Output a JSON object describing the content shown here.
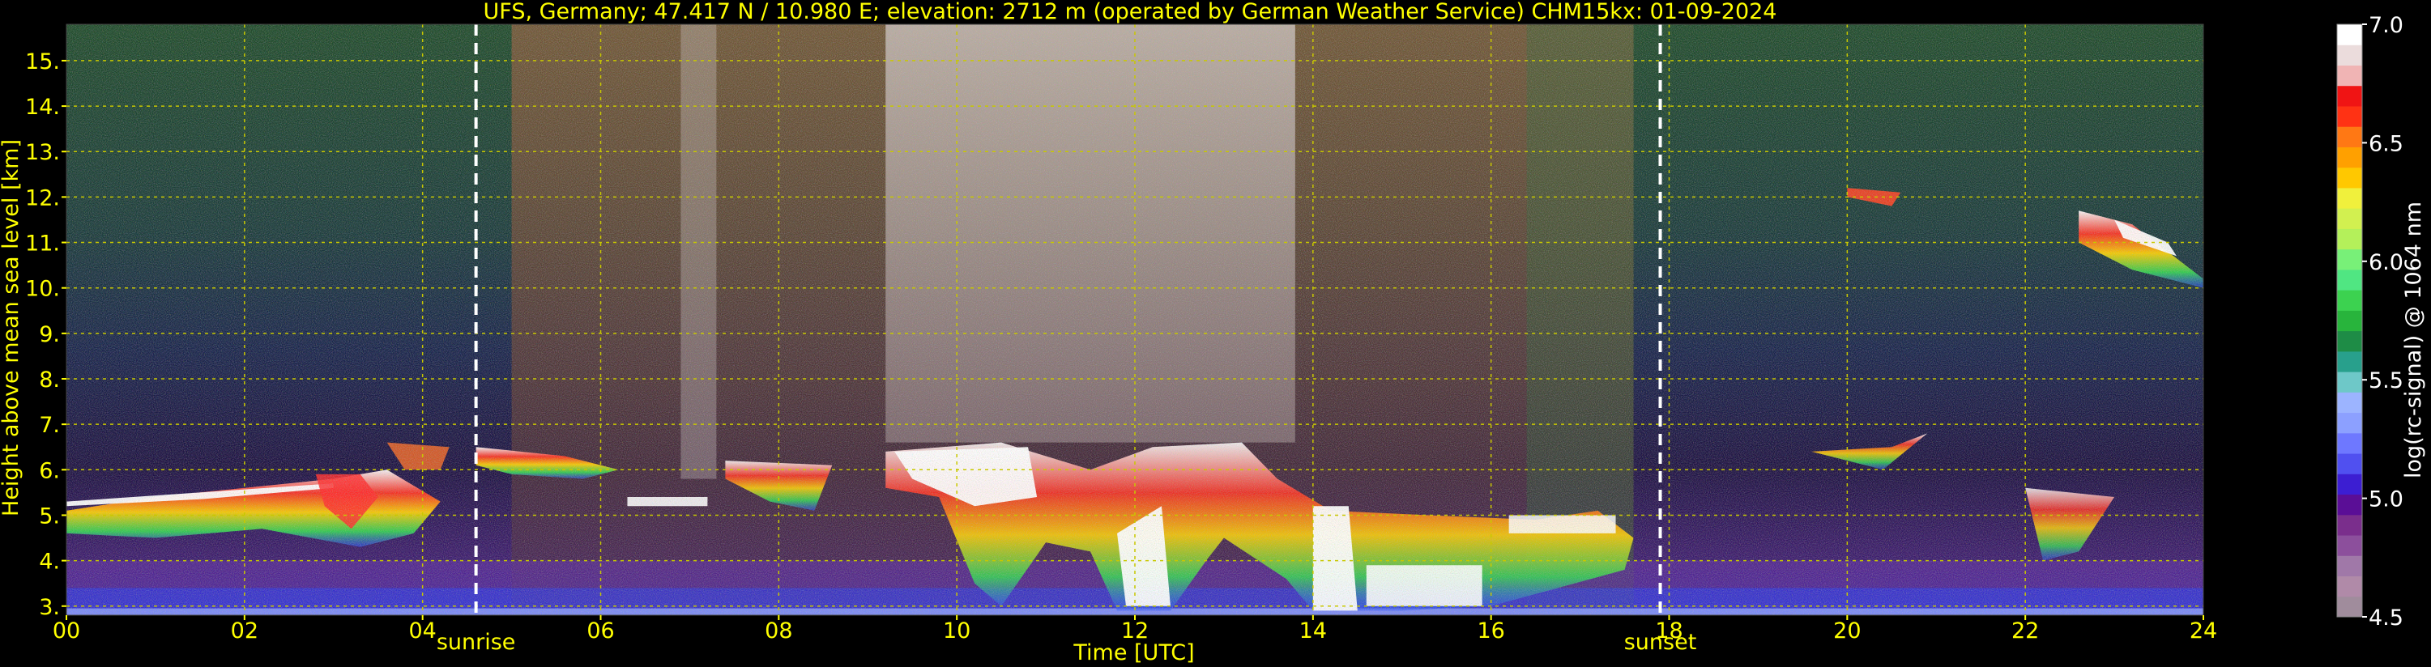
{
  "chart_data": {
    "type": "heatmap",
    "title": "UFS, Germany; 47.417 N / 10.980 E; elevation: 2712 m  (operated by German Weather Service)    CHM15kx: 01-09-2024",
    "xlabel": "Time [UTC]",
    "ylabel": "Height above mean sea level [km]",
    "xlim": [
      0,
      24
    ],
    "ylim": [
      2.8,
      15.8
    ],
    "x_ticks": [
      "00",
      "02",
      "04",
      "06",
      "08",
      "10",
      "12",
      "14",
      "16",
      "18",
      "20",
      "22",
      "24"
    ],
    "x_tick_values": [
      0,
      2,
      4,
      6,
      8,
      10,
      12,
      14,
      16,
      18,
      20,
      22,
      24
    ],
    "y_ticks": [
      "3.",
      "4.",
      "5.",
      "6.",
      "7.",
      "8.",
      "9.",
      "10.",
      "11.",
      "12.",
      "13.",
      "14.",
      "15."
    ],
    "y_tick_values": [
      3,
      4,
      5,
      6,
      7,
      8,
      9,
      10,
      11,
      12,
      13,
      14,
      15
    ],
    "grid": true,
    "annotations": [
      {
        "text": "sunrise",
        "x": 4.6
      },
      {
        "text": "sunset",
        "x": 17.9
      }
    ],
    "colorbar": {
      "label": "log(rc-signal) @ 1064 nm",
      "range": [
        4.5,
        7.0
      ],
      "ticks": [
        "4.5",
        "5.0",
        "5.5",
        "6.0",
        "6.5",
        "7.0"
      ],
      "tick_values": [
        4.5,
        5.0,
        5.5,
        6.0,
        6.5,
        7.0
      ],
      "colors": [
        "#a08c9c",
        "#b08aa8",
        "#a078a8",
        "#8c4f9c",
        "#7a2e8c",
        "#5a0e96",
        "#3c1ed2",
        "#5050f0",
        "#6e78ff",
        "#8ca0ff",
        "#9cb4ff",
        "#6ec8c8",
        "#28a08c",
        "#1e8c46",
        "#28b43c",
        "#3cd250",
        "#50e682",
        "#78f078",
        "#b4f05a",
        "#d2f050",
        "#f0f03c",
        "#ffc800",
        "#ffa000",
        "#ff7814",
        "#ff3214",
        "#f01414",
        "#f0b4b4",
        "#ebdcdc",
        "#ffffff"
      ]
    },
    "features": [
      {
        "name": "low cloud layer",
        "x_range": [
          0,
          4.3
        ],
        "height_km": [
          4.6,
          6.0
        ]
      },
      {
        "name": "sunrise marker",
        "x": 4.6
      },
      {
        "name": "morning cloud",
        "x_range": [
          4.6,
          6.2
        ],
        "height_km": [
          6.0,
          6.5
        ]
      },
      {
        "name": "convective cloud",
        "x_range": [
          9.2,
          17.6
        ],
        "height_km": [
          2.9,
          6.6
        ]
      },
      {
        "name": "sunset marker",
        "x": 17.9
      },
      {
        "name": "evening cirrus",
        "x_range": [
          20.0,
          20.6
        ],
        "height_km": [
          11.8,
          12.2
        ]
      },
      {
        "name": "cirrus",
        "x_range": [
          22.5,
          24.0
        ],
        "height_km": [
          10.0,
          11.7
        ]
      },
      {
        "name": "night cloud",
        "x_range": [
          22.0,
          23.0
        ],
        "height_km": [
          4.0,
          5.6
        ]
      }
    ],
    "colors": {
      "text": "#ffff00",
      "grid": "#c8c800",
      "background": "#000000",
      "markers": "#ffffff"
    }
  }
}
